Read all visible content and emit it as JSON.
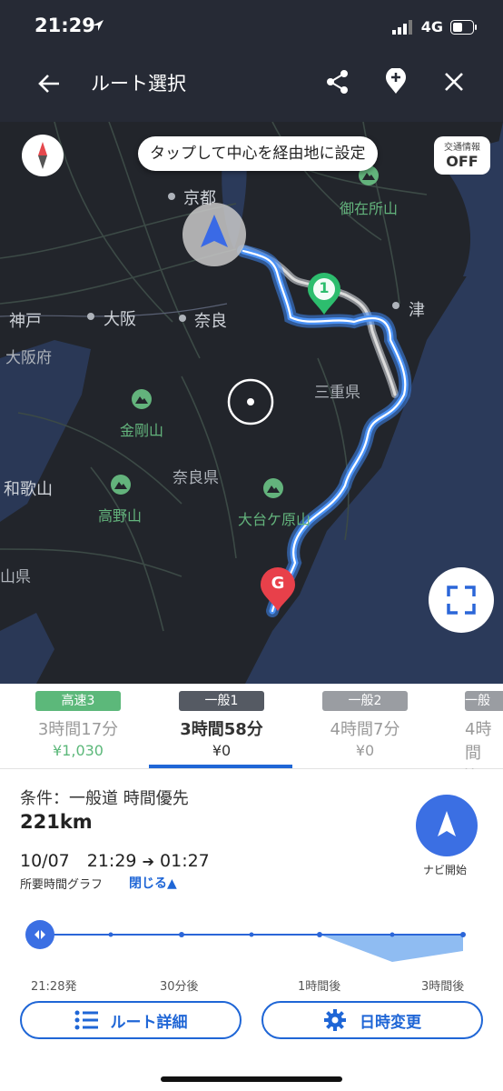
{
  "status_bar": {
    "time": "21:29",
    "network": "4G"
  },
  "header": {
    "title": "ルート選択"
  },
  "map": {
    "tooltip": "タップして中心を経由地に設定",
    "traffic": {
      "label": "交通情報",
      "state": "OFF"
    },
    "labels": {
      "kyoto": "京都",
      "osaka": "大阪",
      "nara": "奈良",
      "kobe": "神戸",
      "tsu": "津",
      "osaka_pref": "大阪府",
      "mie_pref": "三重県",
      "nara_pref": "奈良県",
      "wakayama": "和歌山",
      "wakayama_pref": "山県",
      "kongo": "金剛山",
      "koya": "高野山",
      "odaigahara": "大台ケ原山",
      "gozaisho": "御在所山"
    },
    "waypoint_marker": "1",
    "goal_marker": "G"
  },
  "routes": [
    {
      "badge": "高速3",
      "badge_color": "#5cb87a",
      "duration": "3時間17分",
      "toll": "¥1,030",
      "toll_color": "#5cb87a"
    },
    {
      "badge": "一般1",
      "badge_color": "#555a63",
      "duration": "3時間58分",
      "toll": "¥0",
      "active": true
    },
    {
      "badge": "一般2",
      "badge_color": "#9a9da2",
      "duration": "4時間7分",
      "toll": "¥0"
    },
    {
      "badge": "一般",
      "badge_color": "#9a9da2",
      "duration": "4時間",
      "toll": "¥"
    }
  ],
  "details": {
    "condition": "条件：一般道 時間優先",
    "distance": "221km",
    "departure": "10/07　21:29",
    "arrival": "01:27",
    "arrow": "➔",
    "graph_label": "所要時間グラフ",
    "graph_toggle": "閉じる▲",
    "navi_label": "ナビ開始"
  },
  "graph_ticks": [
    "21:28発",
    "30分後",
    "1時間後",
    "3時間後"
  ],
  "buttons": {
    "route_detail": "ルート詳細",
    "time_change": "日時変更"
  }
}
